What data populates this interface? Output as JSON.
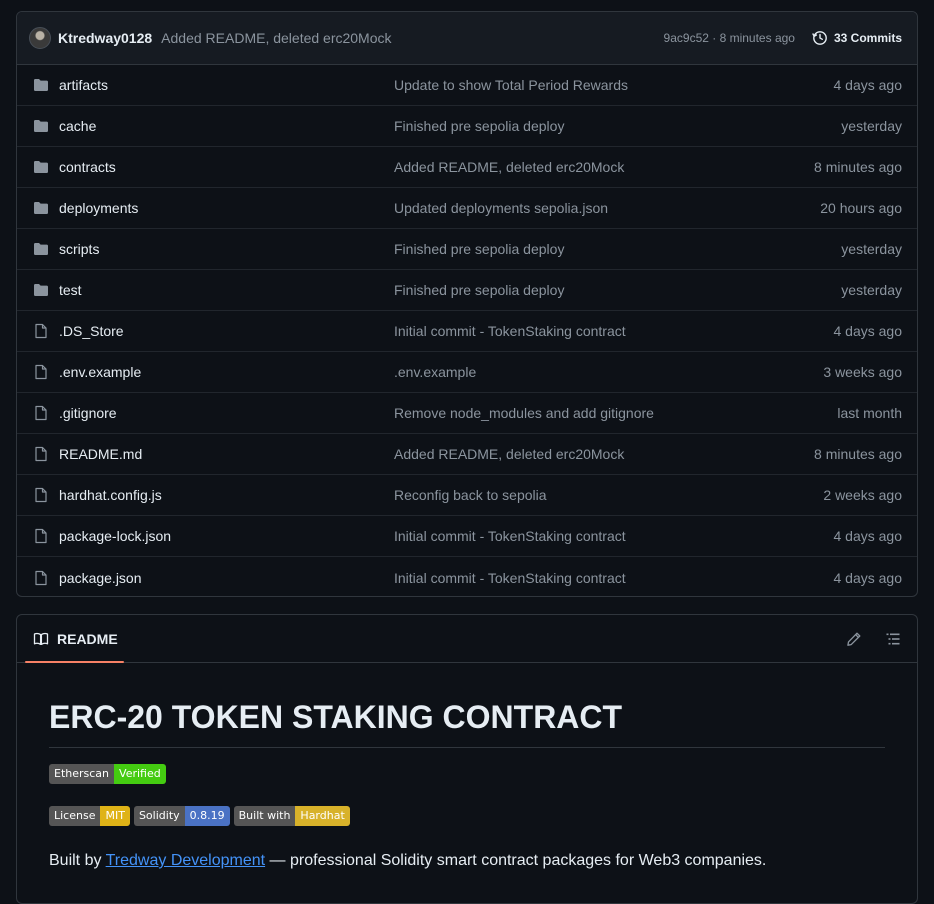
{
  "commit_bar": {
    "author": "Ktredway0128",
    "message": "Added README, deleted erc20Mock",
    "sha_time": "9ac9c52 · 8 minutes ago",
    "commits_label": "33 Commits"
  },
  "files": [
    {
      "type": "folder",
      "icon": "folder-icon",
      "name": "artifacts",
      "message": "Update to show Total Period Rewards",
      "age": "4 days ago"
    },
    {
      "type": "folder",
      "icon": "folder-icon",
      "name": "cache",
      "message": "Finished pre sepolia deploy",
      "age": "yesterday"
    },
    {
      "type": "folder",
      "icon": "folder-icon",
      "name": "contracts",
      "message": "Added README, deleted erc20Mock",
      "age": "8 minutes ago"
    },
    {
      "type": "folder",
      "icon": "folder-icon",
      "name": "deployments",
      "message": "Updated deployments sepolia.json",
      "age": "20 hours ago"
    },
    {
      "type": "folder",
      "icon": "folder-icon",
      "name": "scripts",
      "message": "Finished pre sepolia deploy",
      "age": "yesterday"
    },
    {
      "type": "folder",
      "icon": "folder-icon",
      "name": "test",
      "message": "Finished pre sepolia deploy",
      "age": "yesterday"
    },
    {
      "type": "file",
      "icon": "file-icon",
      "name": ".DS_Store",
      "message": "Initial commit - TokenStaking contract",
      "age": "4 days ago"
    },
    {
      "type": "file",
      "icon": "file-icon",
      "name": ".env.example",
      "message": ".env.example",
      "age": "3 weeks ago"
    },
    {
      "type": "file",
      "icon": "file-icon",
      "name": ".gitignore",
      "message": "Remove node_modules and add gitignore",
      "age": "last month"
    },
    {
      "type": "file",
      "icon": "file-icon",
      "name": "README.md",
      "message": "Added README, deleted erc20Mock",
      "age": "8 minutes ago"
    },
    {
      "type": "file",
      "icon": "file-icon",
      "name": "hardhat.config.js",
      "message": "Reconfig back to sepolia",
      "age": "2 weeks ago"
    },
    {
      "type": "file",
      "icon": "file-icon",
      "name": "package-lock.json",
      "message": "Initial commit - TokenStaking contract",
      "age": "4 days ago"
    },
    {
      "type": "file",
      "icon": "file-icon",
      "name": "package.json",
      "message": "Initial commit - TokenStaking contract",
      "age": "4 days ago"
    }
  ],
  "readme": {
    "tab_label": "README",
    "title": "ERC-20 TOKEN STAKING CONTRACT",
    "badges_row1": [
      {
        "label": "Etherscan",
        "value": "Verified",
        "color": "#4c1"
      }
    ],
    "badges_row2": [
      {
        "label": "License",
        "value": "MIT",
        "color": "#dfb317"
      },
      {
        "label": "Solidity",
        "value": "0.8.19",
        "color": "#4a72c4"
      },
      {
        "label": "Built with",
        "value": "Hardhat",
        "color": "#d8b22a"
      }
    ],
    "byline_prefix": "Built by ",
    "byline_link": "Tredway Development",
    "byline_suffix": " — professional Solidity smart contract packages for Web3 companies."
  },
  "colors": {
    "background": "#0d1117",
    "border": "#30363d",
    "muted_text": "#8b949e",
    "folder_icon": "#8b949e",
    "link": "#4493f8",
    "tab_underline": "#f78166"
  }
}
